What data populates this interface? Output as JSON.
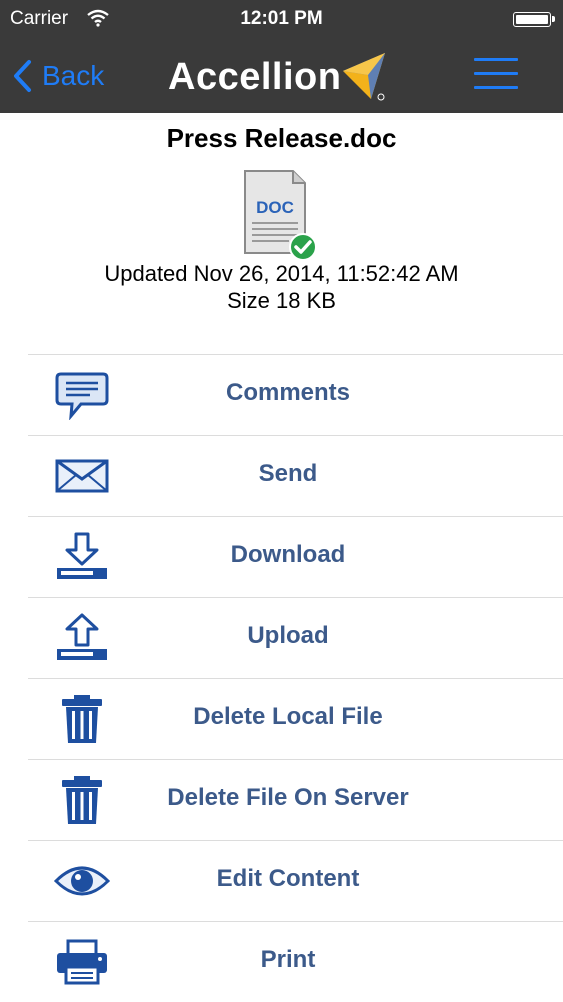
{
  "status": {
    "carrier": "Carrier",
    "time": "12:01 PM"
  },
  "nav": {
    "back_label": "Back",
    "logo_text": "Accellion"
  },
  "file": {
    "name": "Press Release.doc",
    "icon_label": "DOC",
    "updated": "Updated Nov 26, 2014, 11:52:42 AM",
    "size": "Size 18 KB"
  },
  "actions": [
    {
      "label": "Comments",
      "icon": "speech-bubble-icon"
    },
    {
      "label": "Send",
      "icon": "envelope-icon"
    },
    {
      "label": "Download",
      "icon": "download-icon"
    },
    {
      "label": "Upload",
      "icon": "upload-icon"
    },
    {
      "label": "Delete Local File",
      "icon": "trash-icon"
    },
    {
      "label": "Delete File On Server",
      "icon": "trash-icon"
    },
    {
      "label": "Edit Content",
      "icon": "eye-icon"
    },
    {
      "label": "Print",
      "icon": "printer-icon"
    }
  ],
  "colors": {
    "bar": "#3a3a3a",
    "accent": "#1f7cf6",
    "action_text": "#3c5a8a",
    "icon_blue": "#1e4fa0"
  }
}
